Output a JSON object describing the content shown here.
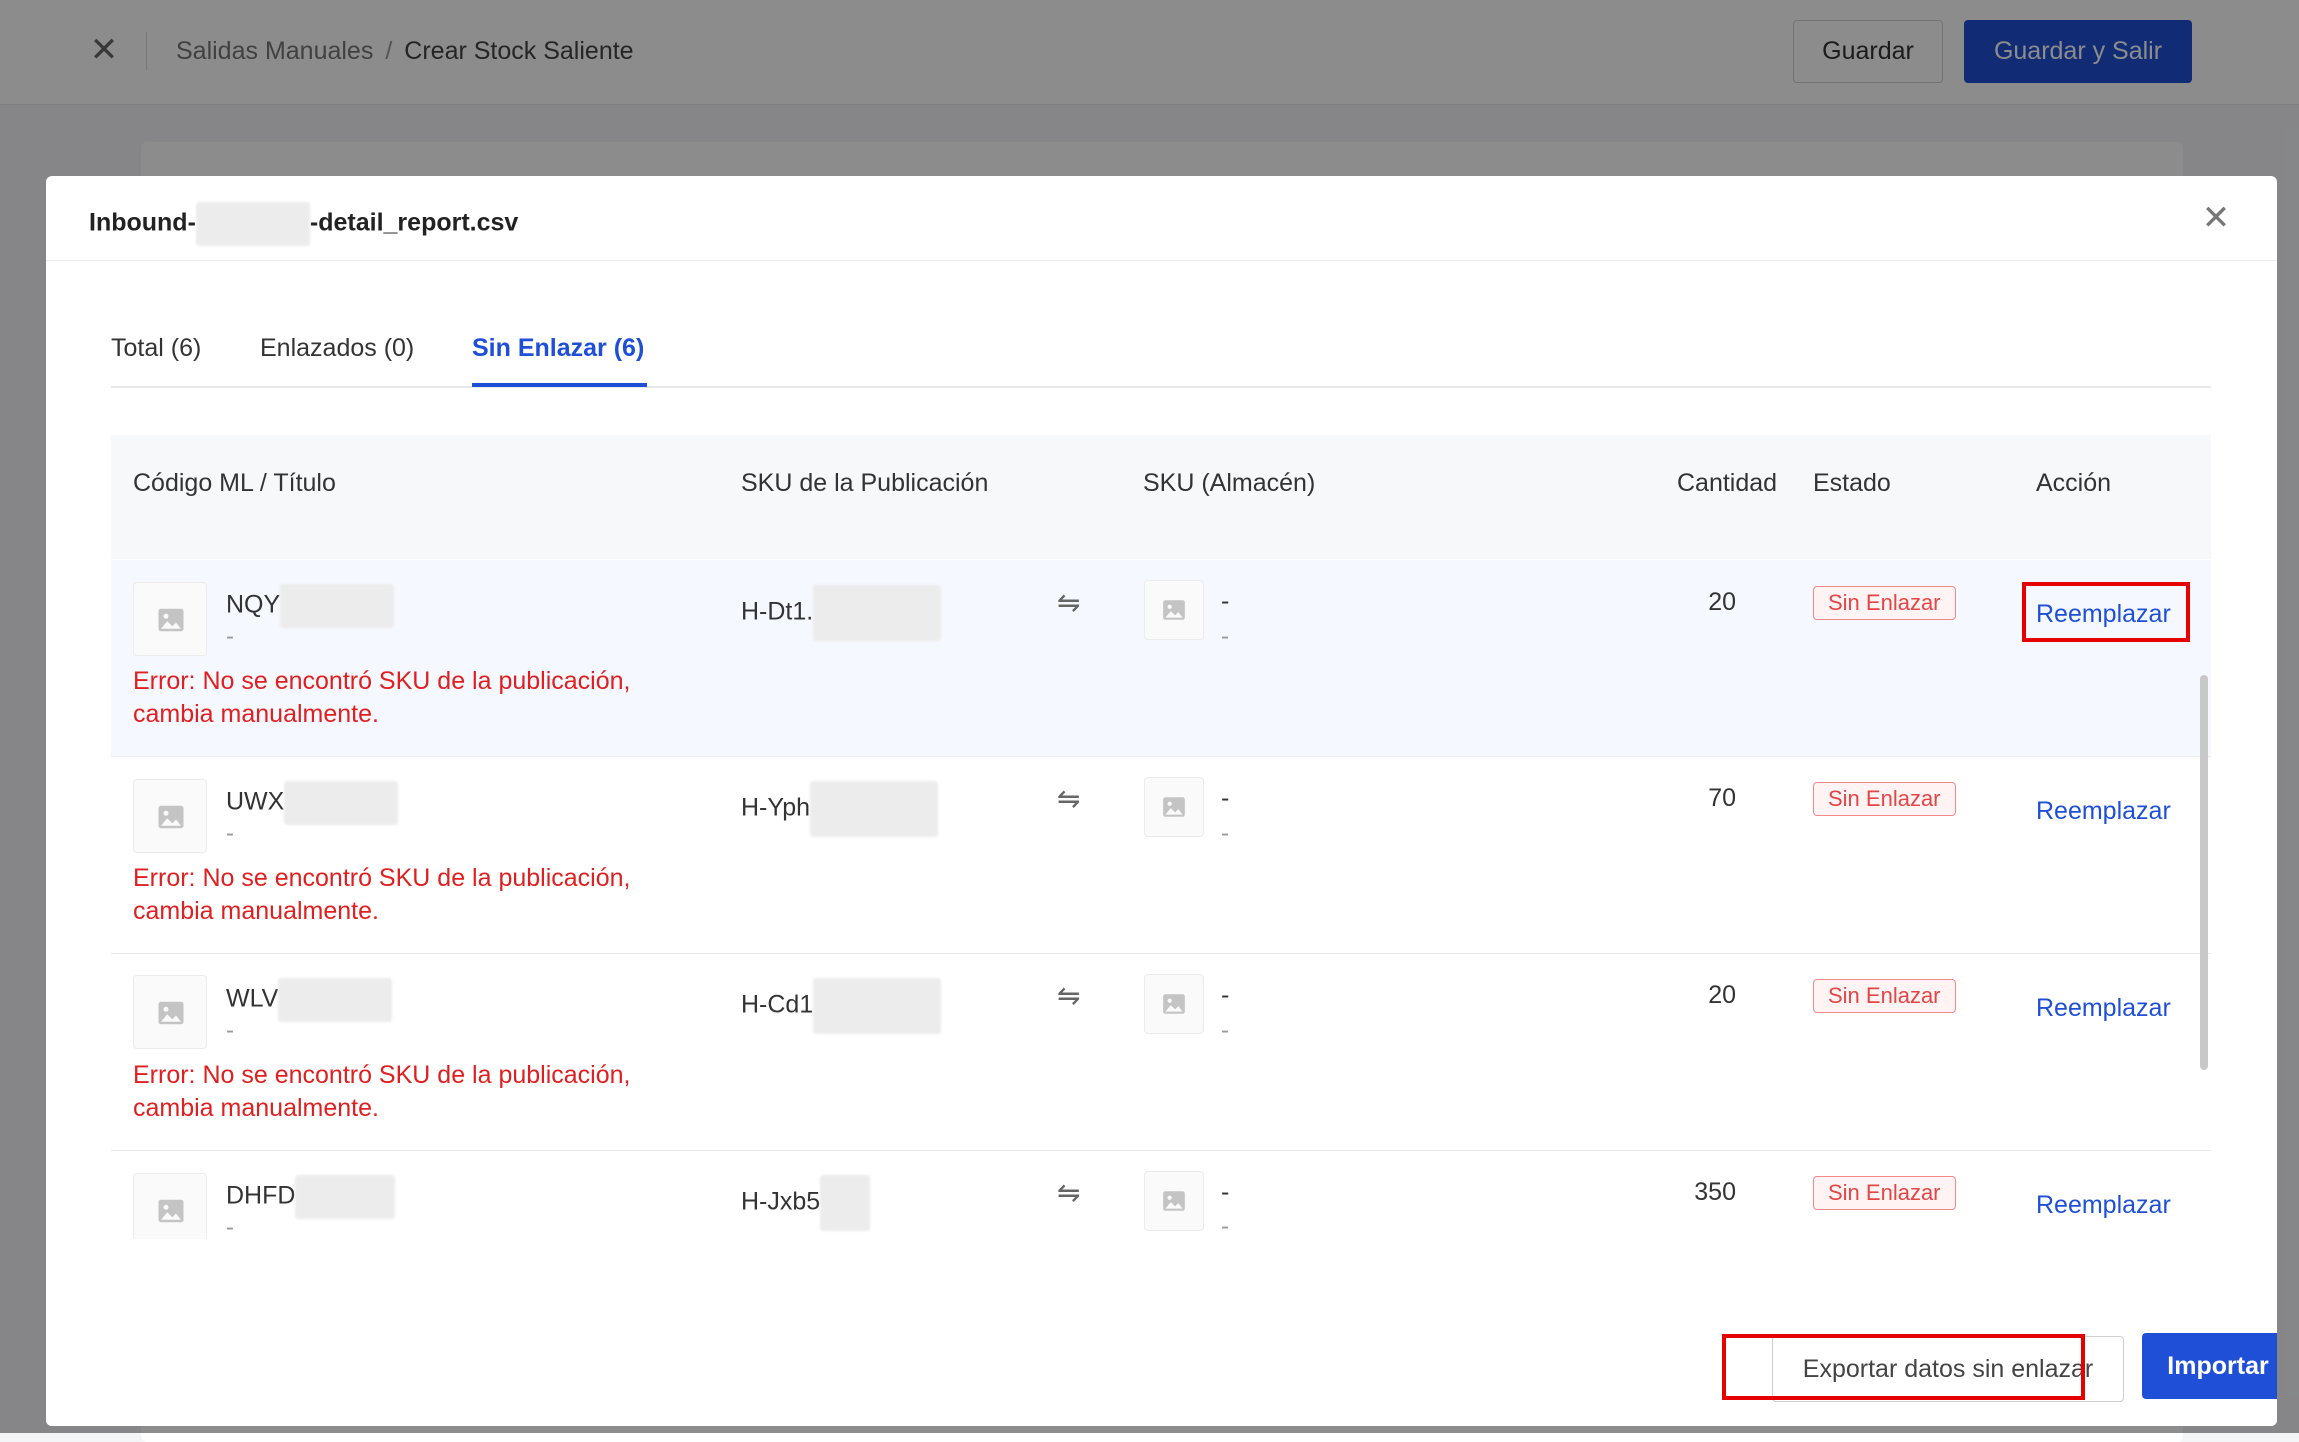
{
  "topbar": {
    "breadcrumb": [
      "Salidas Manuales",
      "Crear Stock Saliente"
    ],
    "separator": "/",
    "save_label": "Guardar",
    "save_exit_label": "Guardar y Salir"
  },
  "modal": {
    "title_prefix": "Inbound-",
    "title_suffix": "-detail_report.csv",
    "tabs": [
      {
        "label": "Total (6)",
        "active": false
      },
      {
        "label": "Enlazados (0)",
        "active": false
      },
      {
        "label": "Sin Enlazar (6)",
        "active": true
      }
    ],
    "columns": {
      "code_title": "Código ML / Título",
      "pub_sku": "SKU de la Publicación",
      "wh_sku": "SKU (Almacén)",
      "qty": "Cantidad",
      "status": "Estado",
      "action": "Acción"
    },
    "rows": [
      {
        "code": "NQY",
        "title": "-",
        "pub_sku": "H-Dt1.",
        "wh_sku": "-",
        "wh_sub": "-",
        "qty": "20",
        "status": "Sin Enlazar",
        "action": "Reemplazar",
        "error_line1": "Error: No se encontró SKU de la publicación,",
        "error_line2": "cambia manualmente."
      },
      {
        "code": "UWX",
        "title": "-",
        "pub_sku": "H-Yph",
        "wh_sku": "-",
        "wh_sub": "-",
        "qty": "70",
        "status": "Sin Enlazar",
        "action": "Reemplazar",
        "error_line1": "Error: No se encontró SKU de la publicación,",
        "error_line2": "cambia manualmente."
      },
      {
        "code": "WLV",
        "title": "-",
        "pub_sku": "H-Cd1",
        "wh_sku": "-",
        "wh_sub": "-",
        "qty": "20",
        "status": "Sin Enlazar",
        "action": "Reemplazar",
        "error_line1": "Error: No se encontró SKU de la publicación,",
        "error_line2": "cambia manualmente."
      },
      {
        "code": "DHFD",
        "title": "-",
        "pub_sku": "H-Jxb5",
        "wh_sku": "-",
        "wh_sub": "-",
        "qty": "350",
        "status": "Sin Enlazar",
        "action": "Reemplazar"
      }
    ],
    "export_label": "Exportar datos sin enlazar",
    "import_label": "Importar"
  },
  "icons": {
    "close": "close-icon",
    "swap": "swap-icon",
    "image_placeholder": "image-placeholder-icon"
  },
  "colors": {
    "primary": "#1f4fd6",
    "error": "#e02020",
    "highlight_box": "#e60000"
  }
}
